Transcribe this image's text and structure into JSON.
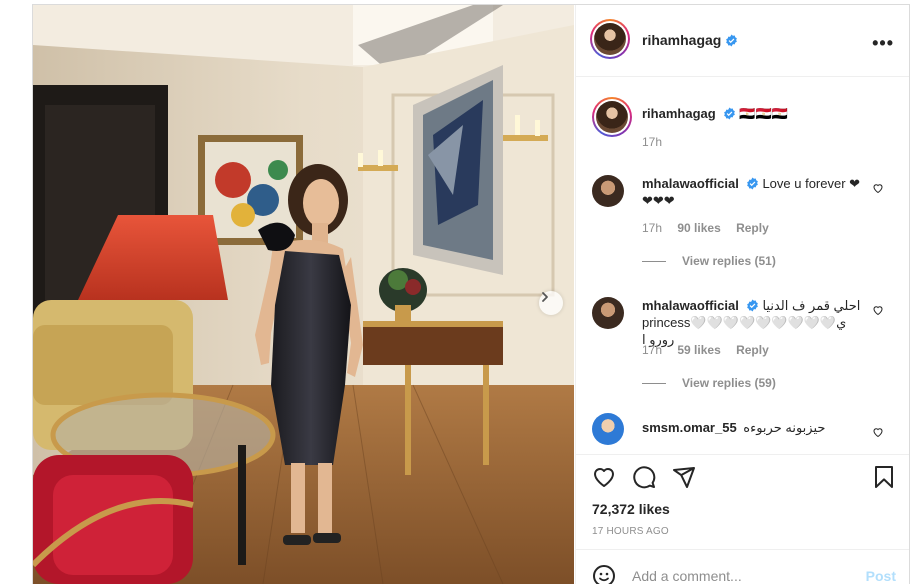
{
  "post": {
    "username": "rihamhagag",
    "caption": "🇪🇬🇪🇬🇪🇬",
    "caption_time": "17h",
    "more_label": "•••"
  },
  "comments": [
    {
      "username": "mhalawaofficial",
      "text": "Love u forever ❤❤❤❤",
      "time": "17h",
      "likes": "90 likes",
      "reply": "Reply",
      "view_replies": "View replies (51)"
    },
    {
      "username": "mhalawaofficial",
      "text": "احلي قمر ف الدنيا princess🤍🤍🤍🤍🤍🤍🤍🤍🤍ي رورو ا",
      "time": "17h",
      "likes": "59 likes",
      "reply": "Reply",
      "view_replies": "View replies (59)"
    },
    {
      "username": "smsm.omar_55",
      "text": "حيزبونه حربوءه"
    }
  ],
  "actions": {
    "likes": "72,372 likes",
    "timestamp": "17 HOURS AGO",
    "comment_placeholder": "Add a comment...",
    "post_label": "Post"
  },
  "icons": {
    "heart": "heart-icon",
    "comment": "comment-icon",
    "share": "share-icon",
    "save": "bookmark-icon",
    "emoji": "emoji-icon",
    "next": "chevron-right-icon",
    "verified": "verified-badge-icon"
  },
  "colors": {
    "verified": "#3897f0",
    "post_disabled": "#b2dffc",
    "meta": "#8e8e8e"
  }
}
